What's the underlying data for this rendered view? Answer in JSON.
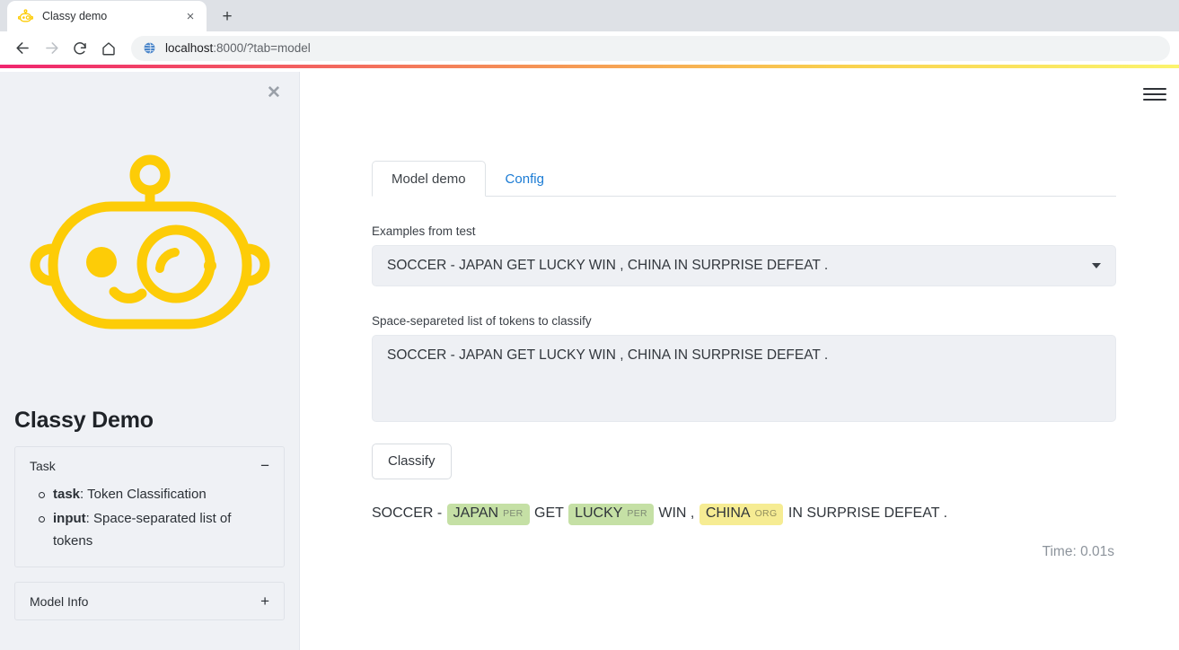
{
  "browser": {
    "tab": {
      "title": "Classy demo",
      "favicon_name": "robot-favicon",
      "close_label": "×"
    },
    "new_tab_label": "+",
    "nav": {
      "back_label": "←",
      "forward_label": "→",
      "reload_label": "⟳",
      "home_label": "⌂"
    },
    "omnibox": {
      "host": "localhost",
      "rest": ":8000/?tab=model",
      "site_icon_name": "globe-icon"
    }
  },
  "sidebar": {
    "close_label": "✕",
    "logo_name": "classy-robot-logo",
    "title": "Classy Demo",
    "accordions": [
      {
        "label": "Task",
        "sign": "−",
        "expanded": true,
        "items": [
          {
            "key": "task",
            "sep": ": ",
            "value": "Token Classification"
          },
          {
            "key": "input",
            "sep": ": ",
            "value": "Space-separated list of tokens"
          }
        ]
      },
      {
        "label": "Model Info",
        "sign": "+",
        "expanded": false,
        "items": []
      }
    ]
  },
  "main": {
    "menu_name": "hamburger-menu-icon",
    "tabs": [
      {
        "label": "Model demo",
        "active": true
      },
      {
        "label": "Config",
        "active": false
      }
    ],
    "examples": {
      "label": "Examples from test",
      "selected": "SOCCER - JAPAN GET LUCKY WIN , CHINA IN SURPRISE DEFEAT ."
    },
    "tokens_input": {
      "label": "Space-separeted list of tokens to classify",
      "value": "SOCCER - JAPAN GET LUCKY WIN , CHINA IN SURPRISE DEFEAT ."
    },
    "classify_button": "Classify",
    "result": {
      "segments": [
        {
          "kind": "plain",
          "text": "SOCCER - "
        },
        {
          "kind": "entity",
          "text": "JAPAN",
          "tag": "PER",
          "type": "per"
        },
        {
          "kind": "plain",
          "text": " GET "
        },
        {
          "kind": "entity",
          "text": "LUCKY",
          "tag": "PER",
          "type": "per"
        },
        {
          "kind": "plain",
          "text": " WIN , "
        },
        {
          "kind": "entity",
          "text": "CHINA",
          "tag": "ORG",
          "type": "org"
        },
        {
          "kind": "plain",
          "text": " IN SURPRISE DEFEAT ."
        }
      ]
    },
    "time_note": "Time: 0.01s"
  },
  "colors": {
    "accent_gradient_start": "#f0256f",
    "accent_gradient_end": "#fbf46d",
    "logo_yellow": "#fdcc07",
    "entity_per_bg": "#c5e0a5",
    "entity_org_bg": "#f6ec93",
    "sidebar_bg": "#eff1f5",
    "field_bg": "#eef0f4",
    "link_blue": "#1a7bd4"
  }
}
